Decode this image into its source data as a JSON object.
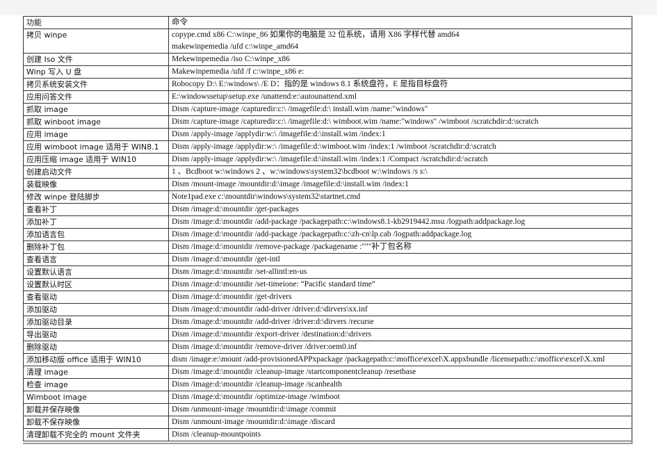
{
  "table": {
    "headers": [
      "功能",
      "命令"
    ],
    "rows": [
      {
        "function": "拷贝 winpe",
        "command": [
          "copype.cmd  x86  C:\\winpe_86 如果你的电脑是 32 位系统，请用 X86 字样代替 amd64",
          "makewinpemedia  /ufd  c:\\winpe_amd64"
        ]
      },
      {
        "function": "创建 Iso 文件",
        "command": [
          "Mekewinpemedia  /iso  C:\\winpe_x86"
        ]
      },
      {
        "function": "Winp 写入 U 盘",
        "command": [
          "Makewinpemedia  /ufd  /f  c:\\winpe_x86  e:"
        ]
      },
      {
        "function": "拷贝系统安装文件",
        "command": [
          "Robocopy  D:\\     E:\\windows\\  /E  D：指的是 windows  8.1 系统盘符，E 是指目标盘符"
        ]
      },
      {
        "function": "应用问答文件",
        "command": [
          "E:\\windowssetup\\setup.exe  /unattend:e:\\autounattend.xml"
        ]
      },
      {
        "function": "抓取 image",
        "command": [
          "Dism  /capture-image  /capturedir:c:\\  /imagefile:d:\\ install.wim  /name:\"windows\""
        ]
      },
      {
        "function": "抓取 winboot  image",
        "command": [
          "Dism  /capture-image  /capturedir:c:\\  /imagefile:d:\\ wimboot.wim  /name:\"windows\"  /wimboot  /scratchdir:d:\\scratch"
        ]
      },
      {
        "function": "应用 image",
        "command": [
          "Dism  /apply-image  /applydir:w:\\  /imagefile:d:\\install.wim  /index:1"
        ]
      },
      {
        "function": "应用 wimboot  image 适用于 WIN8.1",
        "command": [
          "Dism  /apply-image  /applydir:w:\\  /imagefile:d:\\wimboot.wim  /index:1  /wimboot  /scratchdir:d:\\scratch"
        ]
      },
      {
        "function": "应用压缩 image   适用于 WIN10",
        "command": [
          "Dism  /apply-image  /applydir:w:\\  /imagefile:d:\\install.wim  /index:1  /Compact  /scratchdir:d:\\scratch"
        ]
      },
      {
        "function": "创建启动文件",
        "command": [
          "1 、Bcdboot  w:\\windows     2 、w:\\windows\\system32\\bcdboot  w:\\windows  /s  s:\\"
        ]
      },
      {
        "function": "装载映像",
        "command": [
          "Dism  /mount-image  /mountdir:d:\\image  /imagefile:d:\\install.wim  /index:1"
        ]
      },
      {
        "function": "修改 winpe 登陆脚步",
        "command": [
          "Note1pad.exe  c:\\mountdir\\windows\\system32\\startnet.cmd"
        ]
      },
      {
        "function": "查看补丁",
        "command": [
          "Dism  /image:d:\\mountdir  /get-packages"
        ]
      },
      {
        "function": "添加补丁",
        "command": [
          "Dism  /image:d:\\mountdir  /add-package  /packagepath:c:\\windows8.1-kb2919442.msu  /logpath:addpackage.log"
        ]
      },
      {
        "function": "添加语言包",
        "command": [
          "Dism  /image:d:\\mountdir  /add-package  /packagepath:c:\\zh-cn\\lp.cab  /logpath:addpackage.log"
        ]
      },
      {
        "function": "删除补丁包",
        "command": [
          "Dism  /image:d:\\mountdir  /remove-package  /packagename :\"\"\"补丁包名称"
        ]
      },
      {
        "function": "查看语言",
        "command": [
          "Dism  /image:d:\\mountdir  /get-intl"
        ]
      },
      {
        "function": "设置默认语言",
        "command": [
          "Dism  /image:d:\\mountdir  /set-allintl:en-us"
        ]
      },
      {
        "function": "设置默认时区",
        "command": [
          "Dism  /image:d:\\mountdir  /set-timeione: “Pacific  standard  time”"
        ]
      },
      {
        "function": "查看驱动",
        "command": [
          "Dism  /image:d:\\mountdir  /get-drivers"
        ]
      },
      {
        "function": "添加驱动",
        "command": [
          "Dism  /image:d:\\mountdir  /add-driver  /driver:d:\\dirvers\\xx.inf"
        ]
      },
      {
        "function": "添加驱动目录",
        "command": [
          "Dism  /image:d:\\mountdir  /add-driver  /driver:d:\\dirvers  /recurse"
        ]
      },
      {
        "function": "导出驱动",
        "command": [
          "Dism  /image:d:\\mountdir  /export-driver  /destination:d:\\drivers"
        ]
      },
      {
        "function": "删除驱动",
        "command": [
          "Dism  /image:d:\\mountdir  /remove-driver  /driver:oem0.inf"
        ]
      },
      {
        "function": "添加移动版 office 适用于 WIN10",
        "command": [
          "dism  /image:e:\\mount  /add-provisionedAPPxpackage  /packagepath:c:\\moffice\\excel\\X.appxbundle  /licensepath:c:\\moffice\\excel\\X.xml"
        ]
      },
      {
        "function": "清理 image",
        "command": [
          "Dism  /image:d:\\mountdir  /cleanup-image  /startcomponentcleanup  /resetbase"
        ]
      },
      {
        "function": "检查 image",
        "command": [
          "Dism  /image:d:\\mountdir  /cleanup-image  /scanhealth"
        ]
      },
      {
        "function": "Wimboot  image",
        "command": [
          "Dism  /image:d:\\mountdir  /optimize-image  /wimboot"
        ]
      },
      {
        "function": "卸载并保存映像",
        "command": [
          "Dism  /unmount-image  /mountdir:d:\\image  /commit"
        ]
      },
      {
        "function": "卸载不保存映像",
        "command": [
          "Dism  /unmount-image  /mountdir:d:\\image  /discard"
        ]
      },
      {
        "function": "清理卸载不完全的 mount 文件夹",
        "command": [
          "Dism  /cleanup-mountpoints"
        ]
      }
    ]
  }
}
